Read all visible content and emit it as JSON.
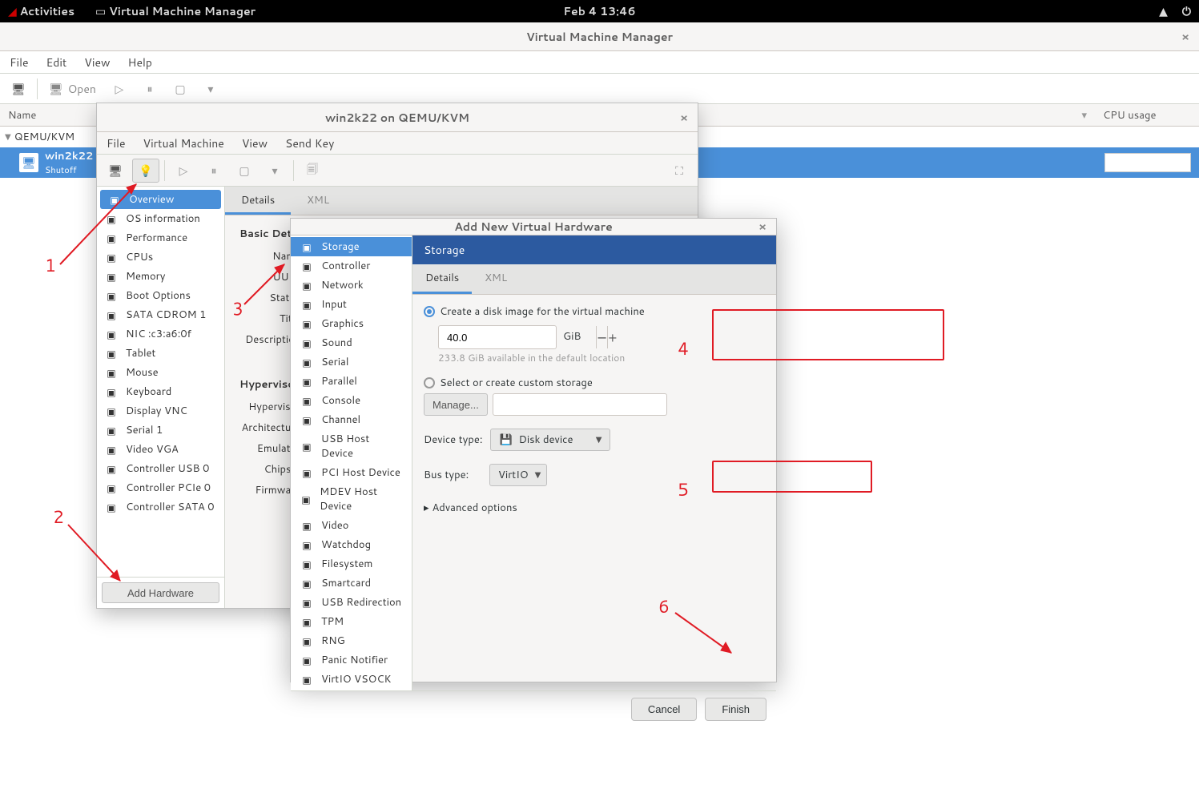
{
  "topbar": {
    "activities": "Activities",
    "app_name": "Virtual Machine Manager",
    "clock": "Feb 4  13:46"
  },
  "main_window": {
    "title": "Virtual Machine Manager",
    "menu": {
      "file": "File",
      "edit": "Edit",
      "view": "View",
      "help": "Help"
    },
    "toolbar": {
      "open": "Open"
    },
    "columns": {
      "name": "Name",
      "cpu": "CPU usage"
    },
    "connection": "QEMU/KVM",
    "vm": {
      "name": "win2k22",
      "state": "Shutoff"
    }
  },
  "detail_window": {
    "title": "win2k22 on QEMU/KVM",
    "menu": {
      "file": "File",
      "vm": "Virtual Machine",
      "view": "View",
      "sendkey": "Send Key"
    },
    "tabs": {
      "details": "Details",
      "xml": "XML"
    },
    "section_basic": "Basic Details",
    "fields": {
      "name": "Name:",
      "uuid": "UUID:",
      "status": "Status:",
      "title": "Title:",
      "description": "Description:"
    },
    "section_hyper": "Hypervisor Details",
    "hyperfields": {
      "hypervisor": "Hypervisor:",
      "arch": "Architecture:",
      "emulator": "Emulator:",
      "chipset": "Chipset:",
      "firmware": "Firmware:"
    },
    "hw_items": [
      "Overview",
      "OS information",
      "Performance",
      "CPUs",
      "Memory",
      "Boot Options",
      "SATA CDROM 1",
      "NIC :c3:a6:0f",
      "Tablet",
      "Mouse",
      "Keyboard",
      "Display VNC",
      "Serial 1",
      "Video VGA",
      "Controller USB 0",
      "Controller PCIe 0",
      "Controller SATA 0"
    ],
    "add_hw": "Add Hardware"
  },
  "addhw": {
    "title": "Add New Virtual Hardware",
    "items": [
      "Storage",
      "Controller",
      "Network",
      "Input",
      "Graphics",
      "Sound",
      "Serial",
      "Parallel",
      "Console",
      "Channel",
      "USB Host Device",
      "PCI Host Device",
      "MDEV Host Device",
      "Video",
      "Watchdog",
      "Filesystem",
      "Smartcard",
      "USB Redirection",
      "TPM",
      "RNG",
      "Panic Notifier",
      "VirtIO VSOCK"
    ],
    "header": "Storage",
    "tabs": {
      "details": "Details",
      "xml": "XML"
    },
    "create_label": "Create a disk image for the virtual machine",
    "size_value": "40.0",
    "gib": "GiB",
    "avail": "233.8 GiB available in the default location",
    "select_label": "Select or create custom storage",
    "manage": "Manage...",
    "device_type_label": "Device type:",
    "device_type_value": "Disk device",
    "bus_label": "Bus type:",
    "bus_value": "VirtIO",
    "advanced": "Advanced options",
    "cancel": "Cancel",
    "finish": "Finish"
  },
  "annotations": {
    "a1": "1",
    "a2": "2",
    "a3": "3",
    "a4": "4",
    "a5": "5",
    "a6": "6"
  }
}
